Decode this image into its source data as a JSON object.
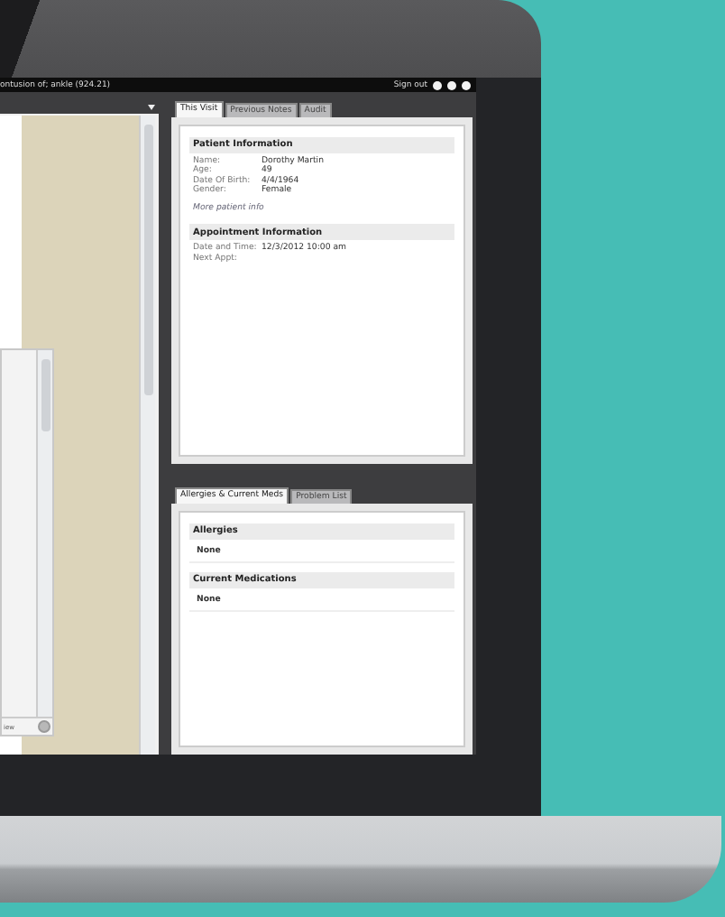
{
  "top_bar": {
    "title": "ontusion of; ankle (924.21)",
    "sign_out": "Sign out"
  },
  "left_panel": {
    "dialog_footer": "iew"
  },
  "visit_tabs": [
    {
      "label": "This Visit",
      "selected": true
    },
    {
      "label": "Previous Notes",
      "selected": false
    },
    {
      "label": "Audit",
      "selected": false
    }
  ],
  "patient_information": {
    "title": "Patient Information",
    "fields": [
      {
        "label": "Name:",
        "value": "Dorothy Martin"
      },
      {
        "label": "Age:",
        "value": "49"
      },
      {
        "label": "Date Of Birth:",
        "value": "4/4/1964"
      },
      {
        "label": "Gender:",
        "value": "Female"
      }
    ],
    "link": "More patient info"
  },
  "appointment_information": {
    "title": "Appointment Information",
    "fields": [
      {
        "label": "Date and Time:",
        "value": "12/3/2012 10:00 am"
      },
      {
        "label": "Next Appt:"
      }
    ]
  },
  "meds_tabs": [
    {
      "label": "Allergies & Current Meds",
      "selected": true
    },
    {
      "label": "Problem List",
      "selected": false
    }
  ],
  "meds_sections": [
    {
      "title": "Allergies",
      "value": "None"
    },
    {
      "title": "Current Medications",
      "value": "None"
    }
  ]
}
